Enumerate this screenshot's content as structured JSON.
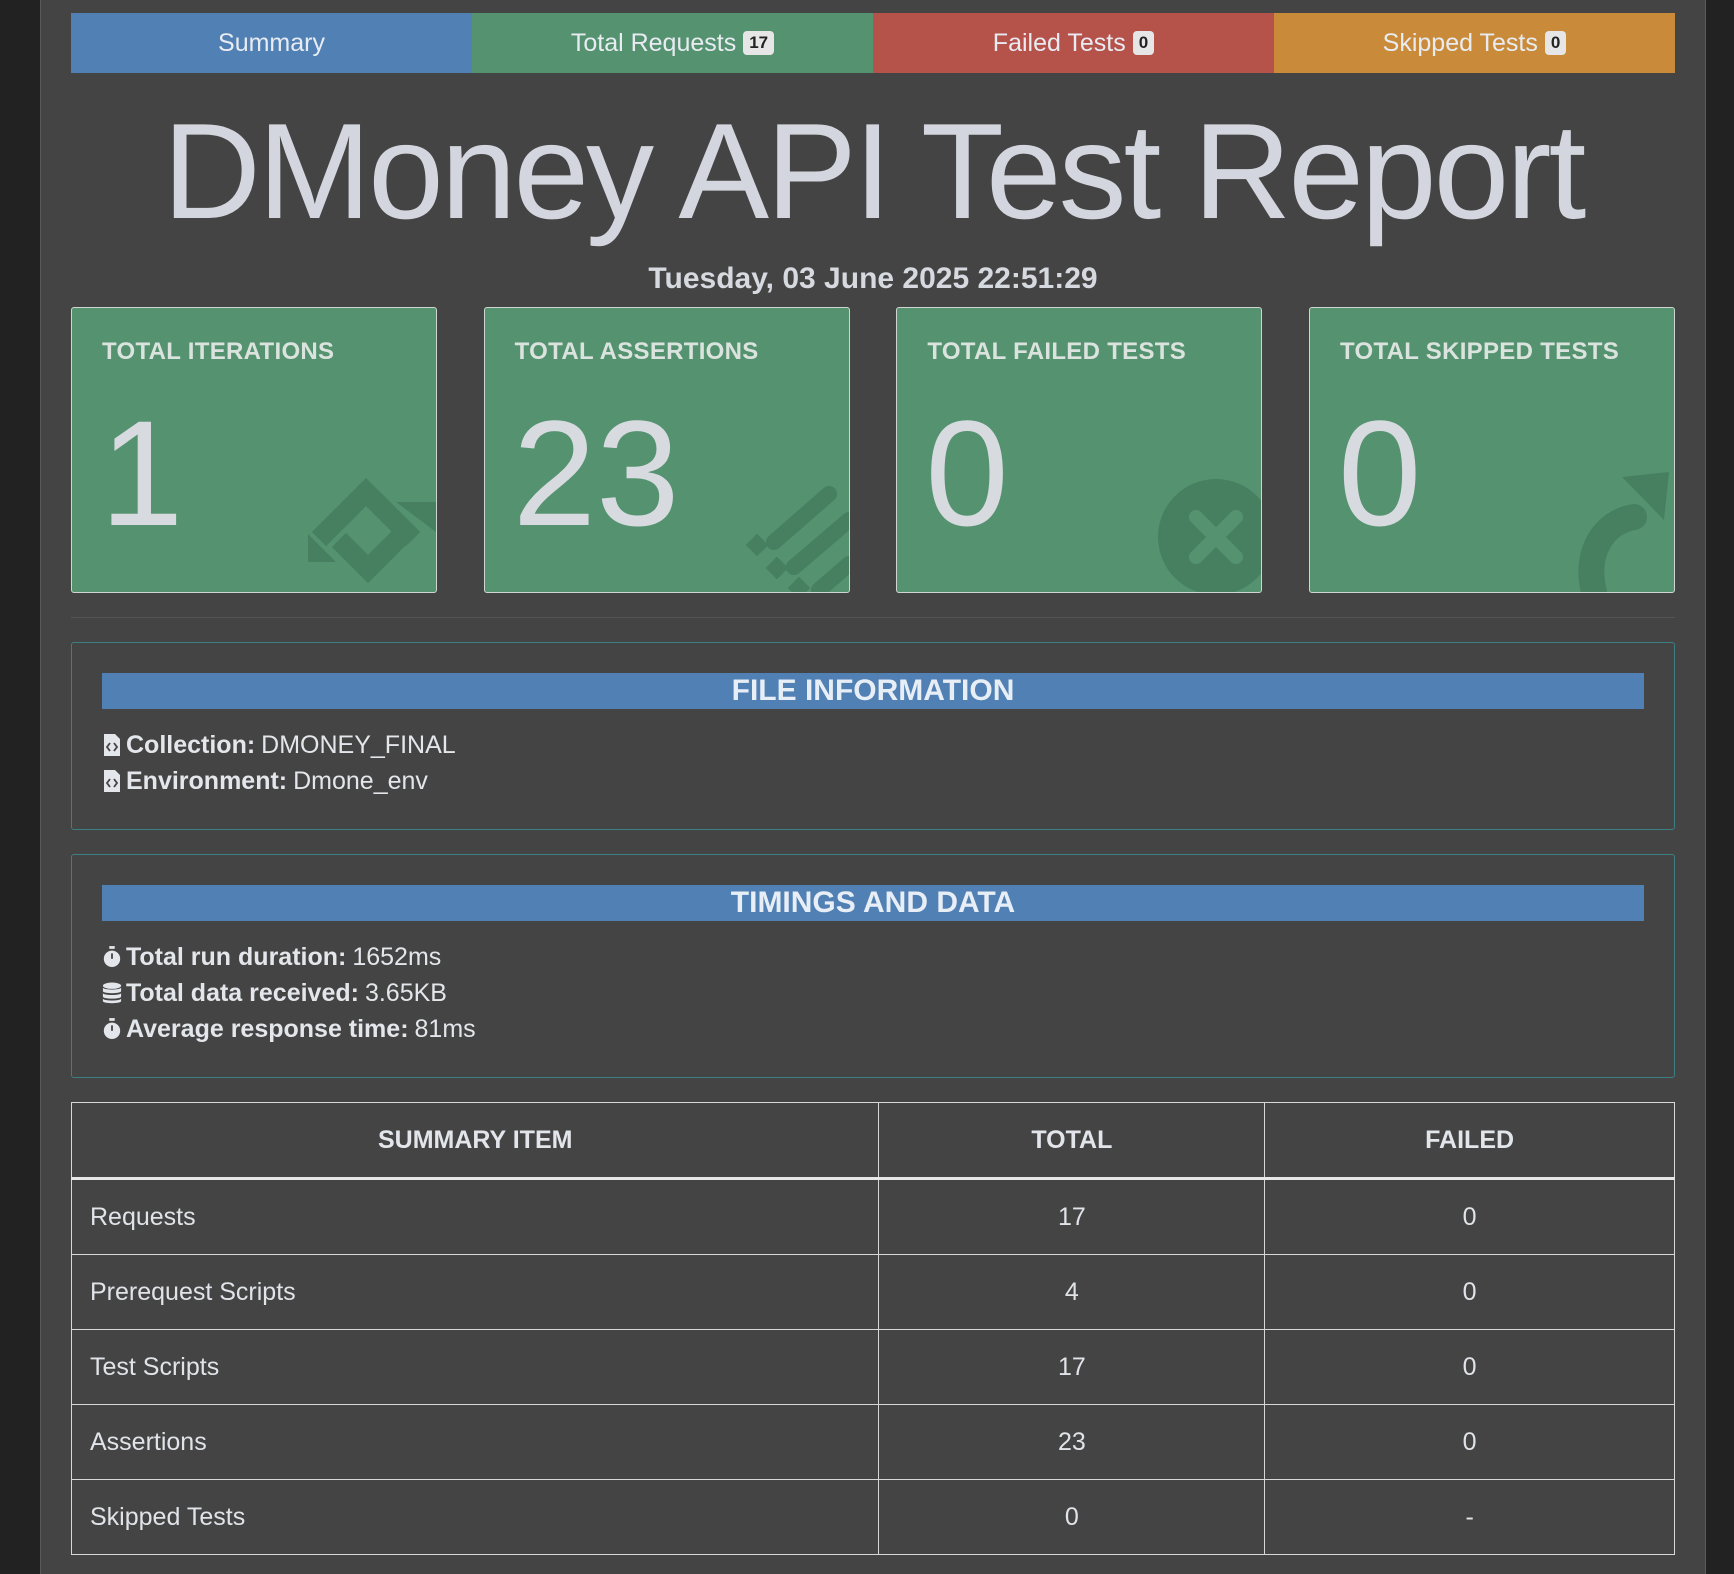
{
  "tabs": [
    {
      "label": "Summary",
      "badge": null,
      "color": "#5080b4"
    },
    {
      "label": "Total Requests",
      "badge": "17",
      "color": "#559370"
    },
    {
      "label": "Failed Tests",
      "badge": "0",
      "color": "#b5524a"
    },
    {
      "label": "Skipped Tests",
      "badge": "0",
      "color": "#c98b3a"
    }
  ],
  "report": {
    "title": "DMoney API Test Report",
    "date": "Tuesday, 03 June 2025 22:51:29"
  },
  "cards": [
    {
      "label": "TOTAL ITERATIONS",
      "value": "1",
      "icon": "sync-icon"
    },
    {
      "label": "TOTAL ASSERTIONS",
      "value": "23",
      "icon": "tasks-icon"
    },
    {
      "label": "TOTAL FAILED TESTS",
      "value": "0",
      "icon": "times-circle-icon"
    },
    {
      "label": "TOTAL SKIPPED TESTS",
      "value": "0",
      "icon": "share-arrow-icon"
    }
  ],
  "file_info": {
    "heading": "FILE INFORMATION",
    "collection_label": "Collection:",
    "collection_value": "DMONEY_FINAL",
    "environment_label": "Environment:",
    "environment_value": "Dmone_env"
  },
  "timings": {
    "heading": "TIMINGS AND DATA",
    "duration_label": "Total run duration:",
    "duration_value": "1652ms",
    "data_label": "Total data received:",
    "data_value": "3.65KB",
    "avg_label": "Average response time:",
    "avg_value": "81ms"
  },
  "summary_table": {
    "headers": [
      "SUMMARY ITEM",
      "TOTAL",
      "FAILED"
    ],
    "rows": [
      {
        "item": "Requests",
        "total": "17",
        "failed": "0"
      },
      {
        "item": "Prerequest Scripts",
        "total": "4",
        "failed": "0"
      },
      {
        "item": "Test Scripts",
        "total": "17",
        "failed": "0"
      },
      {
        "item": "Assertions",
        "total": "23",
        "failed": "0"
      },
      {
        "item": "Skipped Tests",
        "total": "0",
        "failed": "-"
      }
    ]
  }
}
